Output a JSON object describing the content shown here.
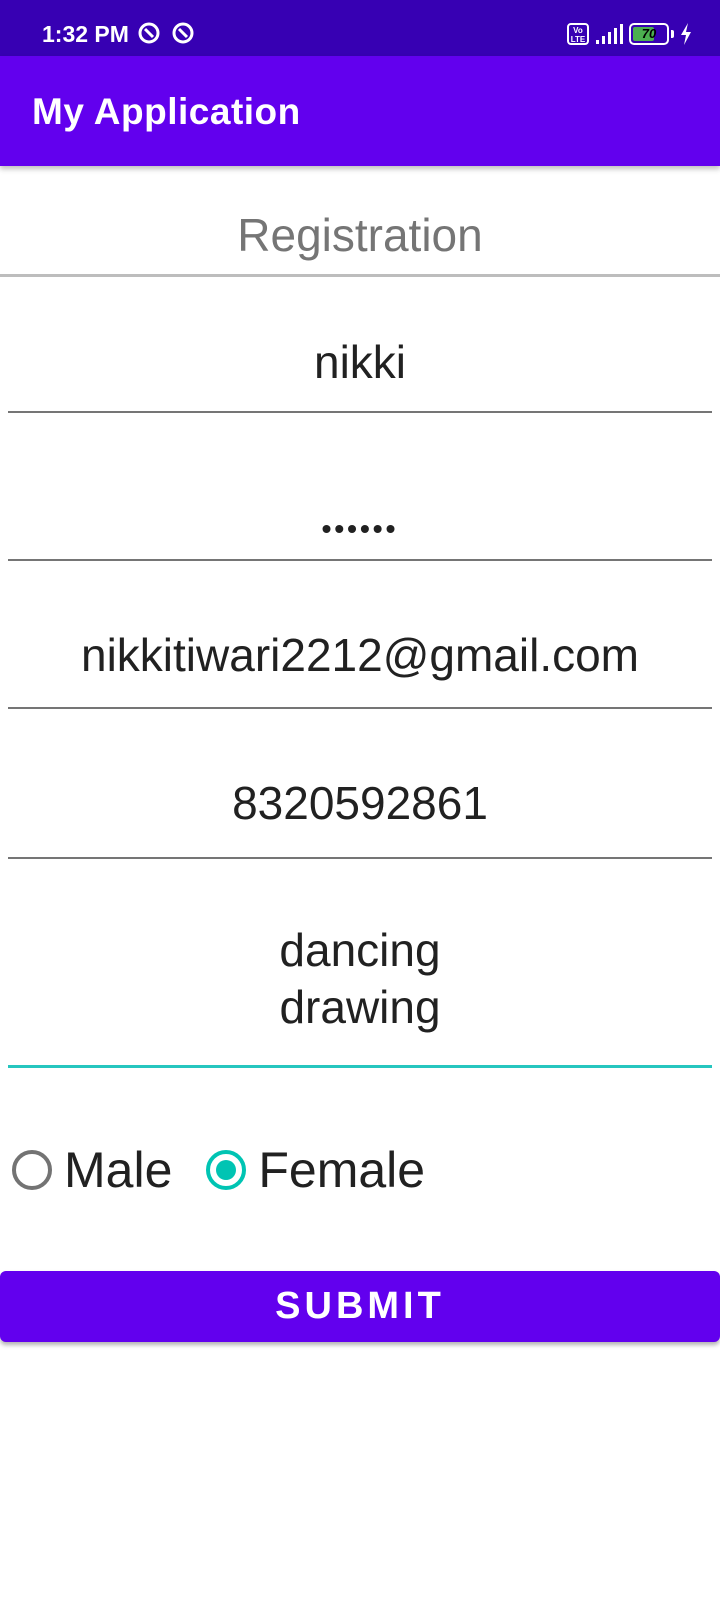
{
  "status_bar": {
    "time": "1:32 PM",
    "volte_label": "Vo LTE",
    "battery_level": "70",
    "battery_fraction": 0.7,
    "icons": [
      "app-notification-icon",
      "app-notification-icon",
      "volte-icon",
      "signal-icon",
      "battery-icon",
      "charging-icon"
    ]
  },
  "app_bar": {
    "title": "My Application"
  },
  "form": {
    "heading": "Registration",
    "name_value": "nikki",
    "password_mask": "••••••",
    "email_value": "nikkitiwari2212@gmail.com",
    "phone_value": "8320592861",
    "hobbies_line1": "dancing",
    "hobbies_line2": "drawing",
    "gender": {
      "options": [
        "Male",
        "Female"
      ],
      "selected": "Female"
    },
    "submit_label": "SUBMIT"
  },
  "colors": {
    "status_bar": "#3700b3",
    "primary": "#6200ee",
    "accent": "#26c6bf",
    "radio_checked": "#00c4b3"
  }
}
